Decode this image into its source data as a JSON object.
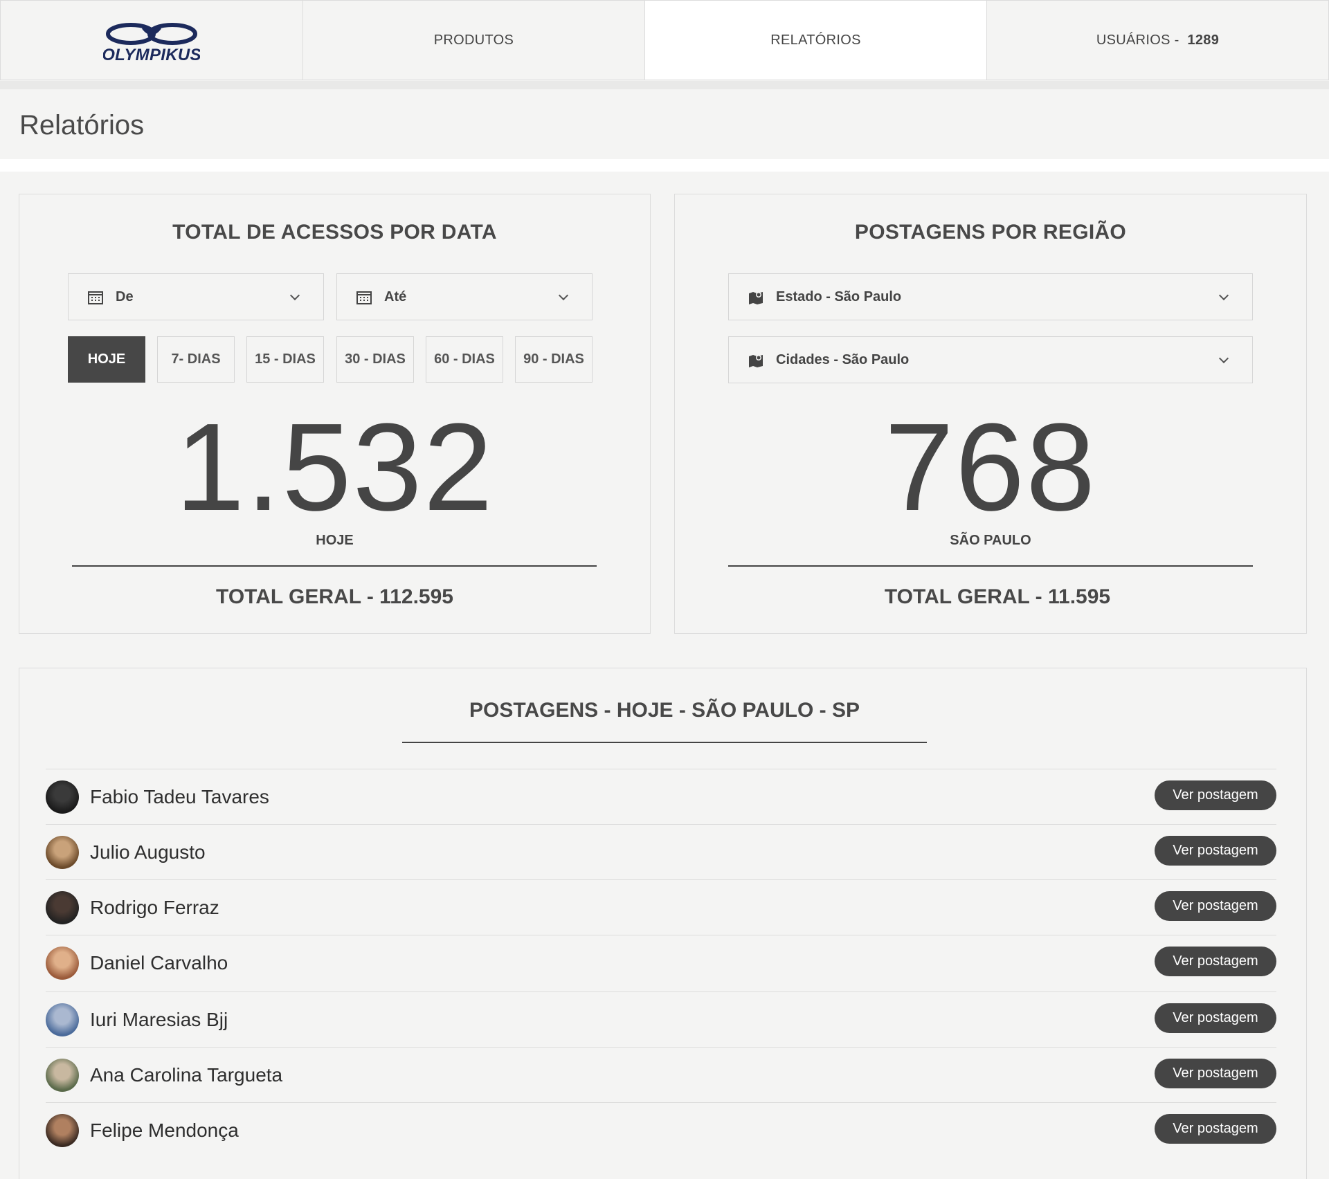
{
  "nav": {
    "logo_text": "OLYMPIKUS",
    "items": [
      {
        "label": "PRODUTOS"
      },
      {
        "label": "RELATÓRIOS"
      },
      {
        "label": "USUÁRIOS - ",
        "count": "1289"
      }
    ]
  },
  "page": {
    "title": "Relatórios"
  },
  "accesses": {
    "title": "TOTAL DE ACESSOS POR DATA",
    "from_label": "De",
    "to_label": "Até",
    "ranges": [
      "HOJE",
      "7- DIAS",
      "15 - DIAS",
      "30 - DIAS",
      "60 - DIAS",
      "90 - DIAS"
    ],
    "active_range": "HOJE",
    "value": "1.532",
    "value_label": "HOJE",
    "total": "TOTAL GERAL - 112.595"
  },
  "region": {
    "title": "POSTAGENS POR REGIÃO",
    "state_label": "Estado - São Paulo",
    "city_label": "Cidades - São Paulo",
    "value": "768",
    "value_label": "SÃO PAULO",
    "total": "TOTAL GERAL - 11.595"
  },
  "posts": {
    "title": "POSTAGENS - HOJE - SÃO PAULO - SP",
    "button_label": "Ver postagem",
    "rows": [
      {
        "name": "Fabio Tadeu Tavares"
      },
      {
        "name": "Julio Augusto"
      },
      {
        "name": "Rodrigo Ferraz"
      },
      {
        "name": "Daniel Carvalho"
      },
      {
        "name": "Iuri Maresias Bjj"
      },
      {
        "name": "Ana Carolina Targueta"
      },
      {
        "name": "Felipe Mendonça"
      }
    ]
  },
  "colors": {
    "dark_button": "#454545",
    "panel_bg": "#f4f4f3",
    "logo_blue": "#1c2a5c"
  },
  "icons": [
    "calendar-icon",
    "chevron-down-icon",
    "map-pin-icon",
    "avatar"
  ]
}
